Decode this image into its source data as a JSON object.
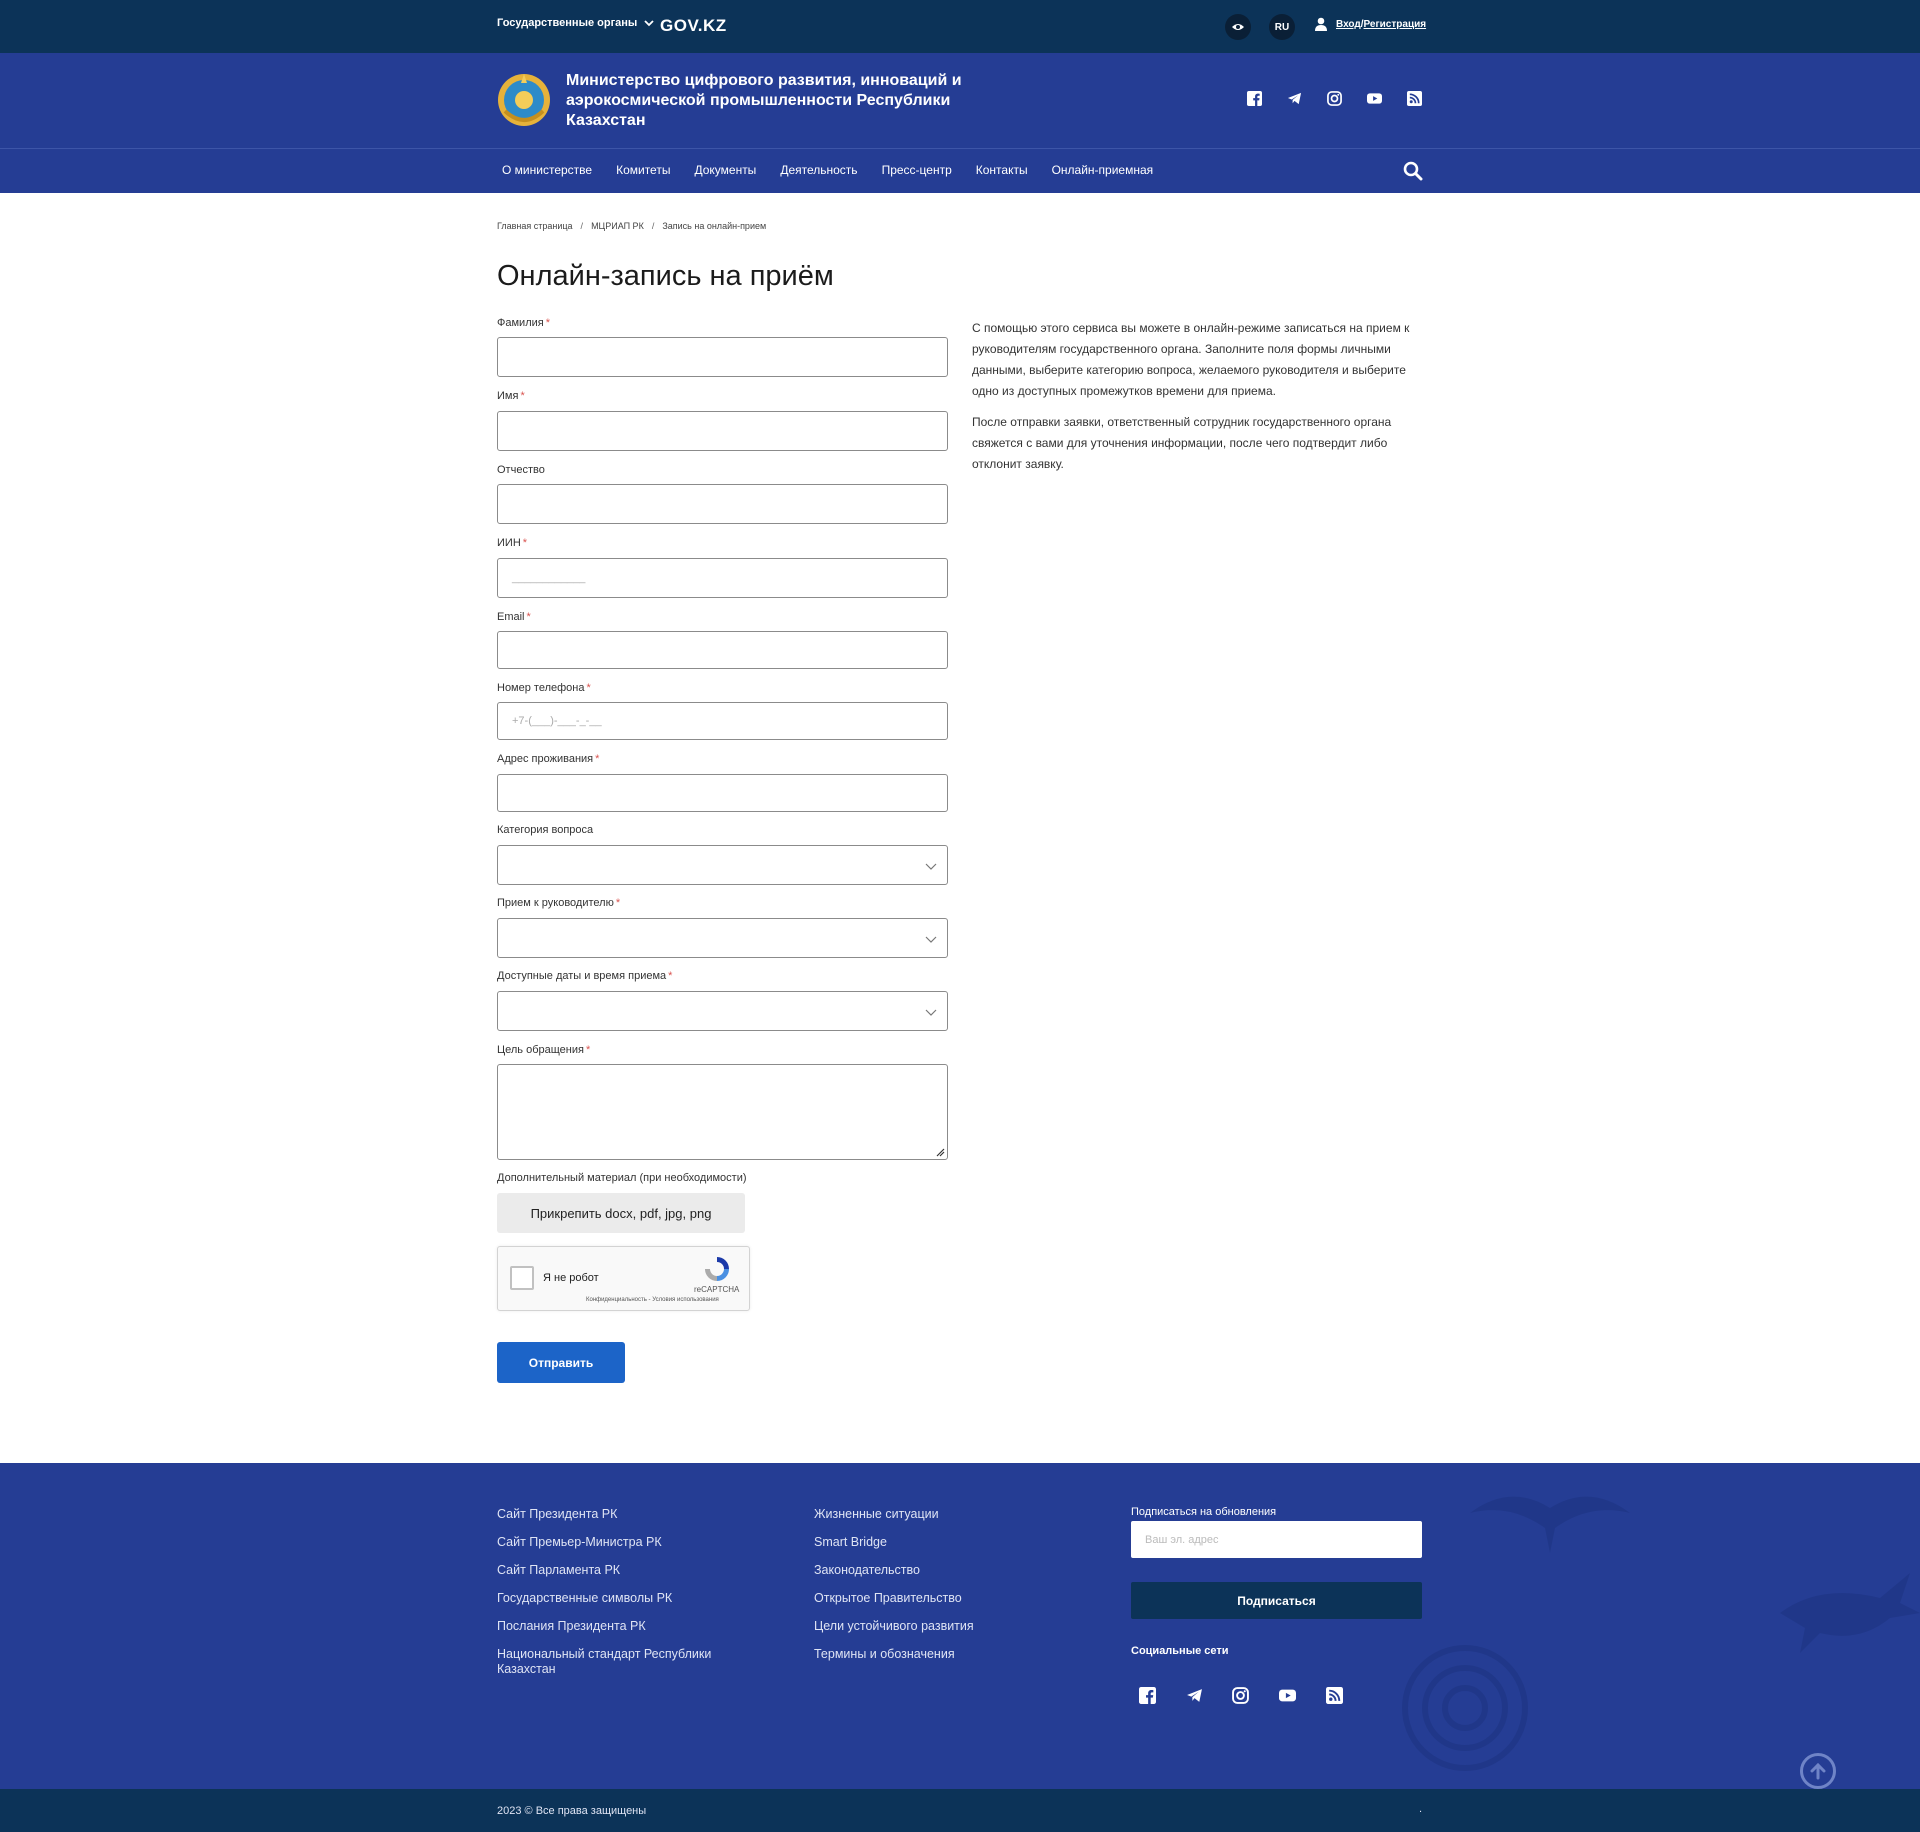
{
  "topbar": {
    "gov_organs": "Государственные органы",
    "govkz": "GOV.KZ",
    "lang": "RU",
    "login": "Вход",
    "login_sep": "/",
    "register": "Регистрация"
  },
  "header": {
    "ministry_name": "Министерство цифрового развития, инноваций и аэрокосмической промышленности Республики Казахстан"
  },
  "nav": {
    "items": [
      "О министерстве",
      "Комитеты",
      "Документы",
      "Деятельность",
      "Пресс-центр",
      "Контакты",
      "Онлайн-приемная"
    ]
  },
  "breadcrumb": {
    "items": [
      "Главная страница",
      "МЦРИАП РК",
      "Запись на онлайн-прием"
    ],
    "sep": "/"
  },
  "page": {
    "title": "Онлайн-запись на приём"
  },
  "form": {
    "required_mark": "*",
    "surname_label": "Фамилия",
    "name_label": "Имя",
    "patronymic_label": "Отчество",
    "iin_label": "ИИН",
    "iin_placeholder": "____________",
    "email_label": "Email",
    "phone_label": "Номер телефона",
    "phone_placeholder": "+7-(___)-___-_-__",
    "address_label": "Адрес проживания",
    "category_label": "Категория вопроса",
    "leader_label": "Прием к руководителю",
    "dates_label": "Доступные даты и время приема",
    "purpose_label": "Цель обращения",
    "additional_label": "Дополнительный материал (при необходимости)",
    "attach_button": "Прикрепить docx, pdf, jpg, png",
    "submit_button": "Отправить"
  },
  "recaptcha": {
    "label": "Я не робот",
    "brand": "reCAPTCHA",
    "links": "Конфиденциальность - Условия использования"
  },
  "info": {
    "paragraph1": "С помощью этого сервиса вы можете в онлайн-режиме записаться на прием к руководителям государственного органа. Заполните поля формы личными данными, выберите категорию вопроса, желаемого руководителя и выберите одно из доступных промежутков времени для приема.",
    "paragraph2": "После отправки заявки, ответственный сотрудник государственного органа свяжется с вами для уточнения информации, после чего подтвердит либо отклонит заявку."
  },
  "footer": {
    "col1": [
      "Сайт Президента РК",
      "Сайт Премьер-Министра РК",
      "Сайт Парламента РК",
      "Государственные символы РК",
      "Послания Президента РК",
      "Национальный стандарт Республики Казахстан"
    ],
    "col2": [
      "Жизненные ситуации",
      "Smart Bridge",
      "Законодательство",
      "Открытое Правительство",
      "Цели устойчивого развития",
      "Термины и обозначения"
    ],
    "subscribe_label": "Подписаться на обновления",
    "subscribe_placeholder": "Ваш эл. адрес",
    "subscribe_button": "Подписаться",
    "social_label": "Социальные сети",
    "copyright": "2023 © Все права защищены",
    "dot": "."
  },
  "colors": {
    "topbar": "#0c3358",
    "header": "#253d94",
    "primary_button": "#1c64c8",
    "required": "#d9534f"
  },
  "icons": [
    "eye-icon",
    "user-icon",
    "chevron-down-icon",
    "facebook-icon",
    "telegram-icon",
    "instagram-icon",
    "youtube-icon",
    "rss-icon",
    "search-icon",
    "emblem-icon",
    "recaptcha-icon",
    "arrow-up-icon"
  ]
}
